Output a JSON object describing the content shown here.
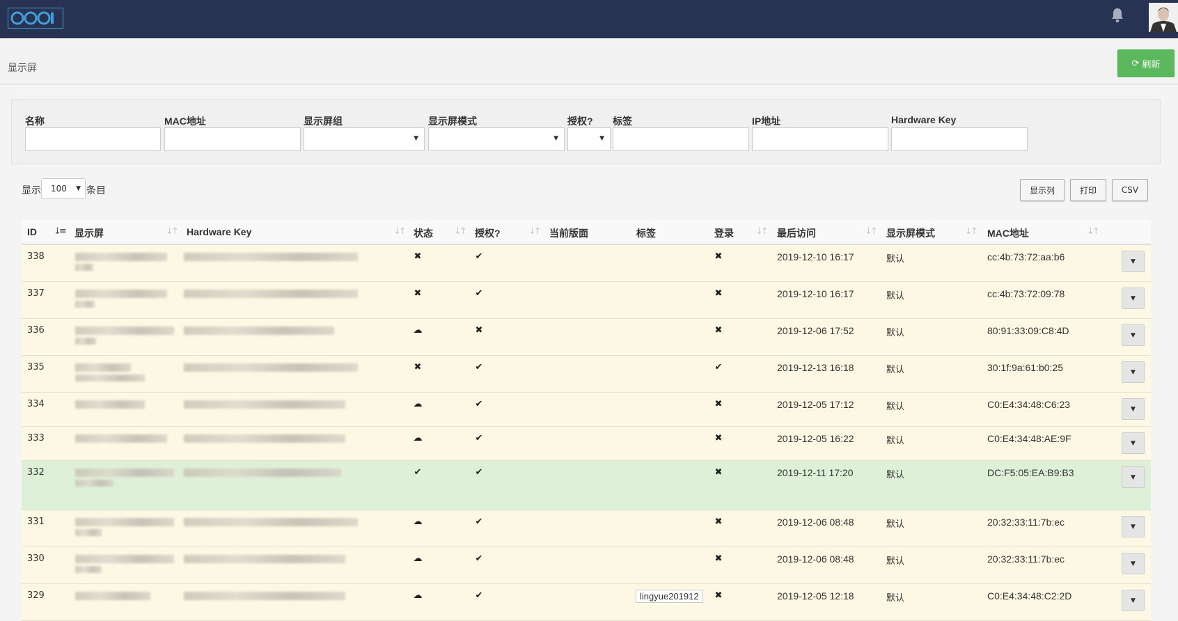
{
  "page": {
    "title": "显示屏",
    "refresh_label": "刷新"
  },
  "filters": {
    "name": "名称",
    "mac": "MAC地址",
    "group": "显示屏组",
    "mode": "显示屏模式",
    "authorised": "授权?",
    "tags": "标签",
    "ip": "IP地址",
    "hardware_key": "Hardware Key"
  },
  "table_controls": {
    "show_prefix": "显示",
    "page_size": "100",
    "entries_suffix": "条目",
    "columns_label": "显示列",
    "print_label": "打印",
    "csv_label": "CSV"
  },
  "columns": [
    "ID",
    "显示屏",
    "Hardware Key",
    "状态",
    "授权?",
    "当前版面",
    "标签",
    "登录",
    "最后访问",
    "显示屏模式",
    "MAC地址"
  ],
  "rows": [
    {
      "id": "338",
      "status": "cross",
      "auth": "check",
      "tag": "",
      "login": "cross",
      "last": "2019-12-10 16:17",
      "mode": "默认",
      "mac": "cc:4b:73:72:aa:b6"
    },
    {
      "id": "337",
      "status": "cross",
      "auth": "check",
      "tag": "",
      "login": "cross",
      "last": "2019-12-10 16:17",
      "mode": "默认",
      "mac": "cc:4b:73:72:09:78"
    },
    {
      "id": "336",
      "status": "cloud",
      "auth": "cross",
      "tag": "",
      "login": "cross",
      "last": "2019-12-06 17:52",
      "mode": "默认",
      "mac": "80:91:33:09:C8:4D"
    },
    {
      "id": "335",
      "status": "cross",
      "auth": "check",
      "tag": "",
      "login": "check",
      "last": "2019-12-13 16:18",
      "mode": "默认",
      "mac": "30:1f:9a:61:b0:25"
    },
    {
      "id": "334",
      "status": "cloud",
      "auth": "check",
      "tag": "",
      "login": "cross",
      "last": "2019-12-05 17:12",
      "mode": "默认",
      "mac": "C0:E4:34:48:C6:23"
    },
    {
      "id": "333",
      "status": "cloud",
      "auth": "check",
      "tag": "",
      "login": "cross",
      "last": "2019-12-05 16:22",
      "mode": "默认",
      "mac": "C0:E4:34:48:AE:9F"
    },
    {
      "id": "332",
      "status": "check",
      "auth": "check",
      "tag": "",
      "login": "cross",
      "last": "2019-12-11 17:20",
      "mode": "默认",
      "mac": "DC:F5:05:EA:B9:B3"
    },
    {
      "id": "331",
      "status": "cloud",
      "auth": "check",
      "tag": "",
      "login": "cross",
      "last": "2019-12-06 08:48",
      "mode": "默认",
      "mac": "20:32:33:11:7b:ec"
    },
    {
      "id": "330",
      "status": "cloud",
      "auth": "check",
      "tag": "",
      "login": "cross",
      "last": "2019-12-06 08:48",
      "mode": "默认",
      "mac": "20:32:33:11:7b:ec"
    },
    {
      "id": "329",
      "status": "cloud",
      "auth": "check",
      "tag": "lingyue201912",
      "login": "cross",
      "last": "2019-12-05 12:18",
      "mode": "默认",
      "mac": "C0:E4:34:48:C2:2D"
    }
  ],
  "icons": {
    "check": "✔",
    "cross": "✖",
    "cloud": "☁"
  },
  "colors": {
    "topbar": "#283252",
    "row_warning": "#fcf8e3",
    "row_success": "#dff0d8",
    "refresh": "#5cb85c"
  }
}
